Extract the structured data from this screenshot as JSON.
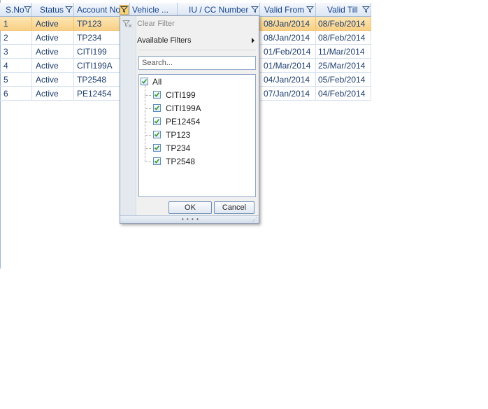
{
  "grid": {
    "columns": [
      {
        "label": "S.No",
        "filter": "funnel-icon"
      },
      {
        "label": "Status",
        "filter": "funnel-icon"
      },
      {
        "label": "Account No",
        "filter": "funnel-icon-active"
      },
      {
        "label": "Vehicle ...",
        "filter": "funnel-icon"
      },
      {
        "label": "IU / CC Number",
        "filter": "funnel-icon"
      },
      {
        "label": "Valid From",
        "filter": "funnel-icon"
      },
      {
        "label": "Valid Till",
        "filter": "funnel-icon"
      }
    ],
    "rows": [
      {
        "sno": "1",
        "status": "Active",
        "account": "TP123",
        "valid_from": "08/Jan/2014",
        "valid_till": "08/Feb/2014",
        "selected": true
      },
      {
        "sno": "2",
        "status": "Active",
        "account": "TP234",
        "valid_from": "08/Jan/2014",
        "valid_till": "08/Feb/2014"
      },
      {
        "sno": "3",
        "status": "Active",
        "account": "CITI199",
        "valid_from": "01/Feb/2014",
        "valid_till": "11/Mar/2014"
      },
      {
        "sno": "4",
        "status": "Active",
        "account": "CITI199A",
        "valid_from": "01/Mar/2014",
        "valid_till": "25/Mar/2014"
      },
      {
        "sno": "5",
        "status": "Active",
        "account": "TP2548",
        "valid_from": "04/Jan/2014",
        "valid_till": "05/Feb/2014"
      },
      {
        "sno": "6",
        "status": "Active",
        "account": "PE12454",
        "valid_from": "07/Jan/2014",
        "valid_till": "04/Feb/2014"
      }
    ]
  },
  "filter_popup": {
    "clear_filter": "Clear Filter",
    "available_filters": "Available Filters",
    "search_placeholder": "Search...",
    "all_label": "All",
    "values": [
      "CITI199",
      "CITI199A",
      "PE12454",
      "TP123",
      "TP234",
      "TP2548"
    ],
    "ok": "OK",
    "cancel": "Cancel",
    "grip": "• • • •"
  },
  "colors": {
    "header_text": "#15428b",
    "cell_text": "#1e3e6e",
    "selected_row": "#f8cf84",
    "active_filter": "#f7d37a",
    "check": "#2f9a2f"
  }
}
